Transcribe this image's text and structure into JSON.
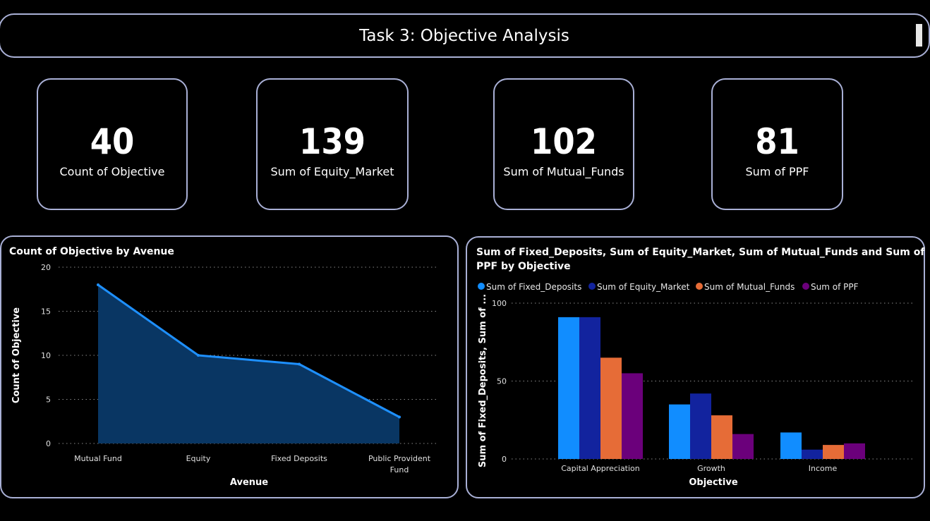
{
  "header": {
    "title": "Task 3: Objective Analysis"
  },
  "cards": [
    {
      "value": "40",
      "label": "Count of Objective"
    },
    {
      "value": "139",
      "label": "Sum of Equity_Market"
    },
    {
      "value": "102",
      "label": "Sum of Mutual_Funds"
    },
    {
      "value": "81",
      "label": "Sum of PPF"
    }
  ],
  "colors": {
    "border": "#a9b0d6",
    "area_line": "#1e90ff",
    "area_fill": "#093663",
    "fixed_deposits": "#118dff",
    "equity_market": "#12239e",
    "mutual_funds": "#e66c37",
    "ppf": "#6b007b"
  },
  "chart_data": [
    {
      "type": "area",
      "title": "Count of Objective by Avenue",
      "xlabel": "Avenue",
      "ylabel": "Count of Objective",
      "categories": [
        "Mutual Fund",
        "Equity",
        "Fixed Deposits",
        "Public Provident Fund"
      ],
      "values": [
        18,
        10,
        9,
        3
      ],
      "ylim": [
        0,
        20
      ],
      "yticks": [
        "0",
        "5",
        "10",
        "15",
        "20"
      ],
      "grid": true
    },
    {
      "type": "bar",
      "title": "Sum of Fixed_Deposits, Sum of Equity_Market, Sum of Mutual_Funds and Sum of PPF by Objective",
      "xlabel": "Objective",
      "ylabel": "Sum of Fixed_Deposits, Sum of ...",
      "categories": [
        "Capital Appreciation",
        "Growth",
        "Income"
      ],
      "series": [
        {
          "name": "Sum of Fixed_Deposits",
          "values": [
            91,
            35,
            17
          ]
        },
        {
          "name": "Sum of Equity_Market",
          "values": [
            91,
            42,
            6
          ]
        },
        {
          "name": "Sum of Mutual_Funds",
          "values": [
            65,
            28,
            9
          ]
        },
        {
          "name": "Sum of PPF",
          "values": [
            55,
            16,
            10
          ]
        }
      ],
      "ylim": [
        0,
        100
      ],
      "yticks": [
        "0",
        "50",
        "100"
      ],
      "grid": true,
      "legend_position": "top-left"
    }
  ]
}
